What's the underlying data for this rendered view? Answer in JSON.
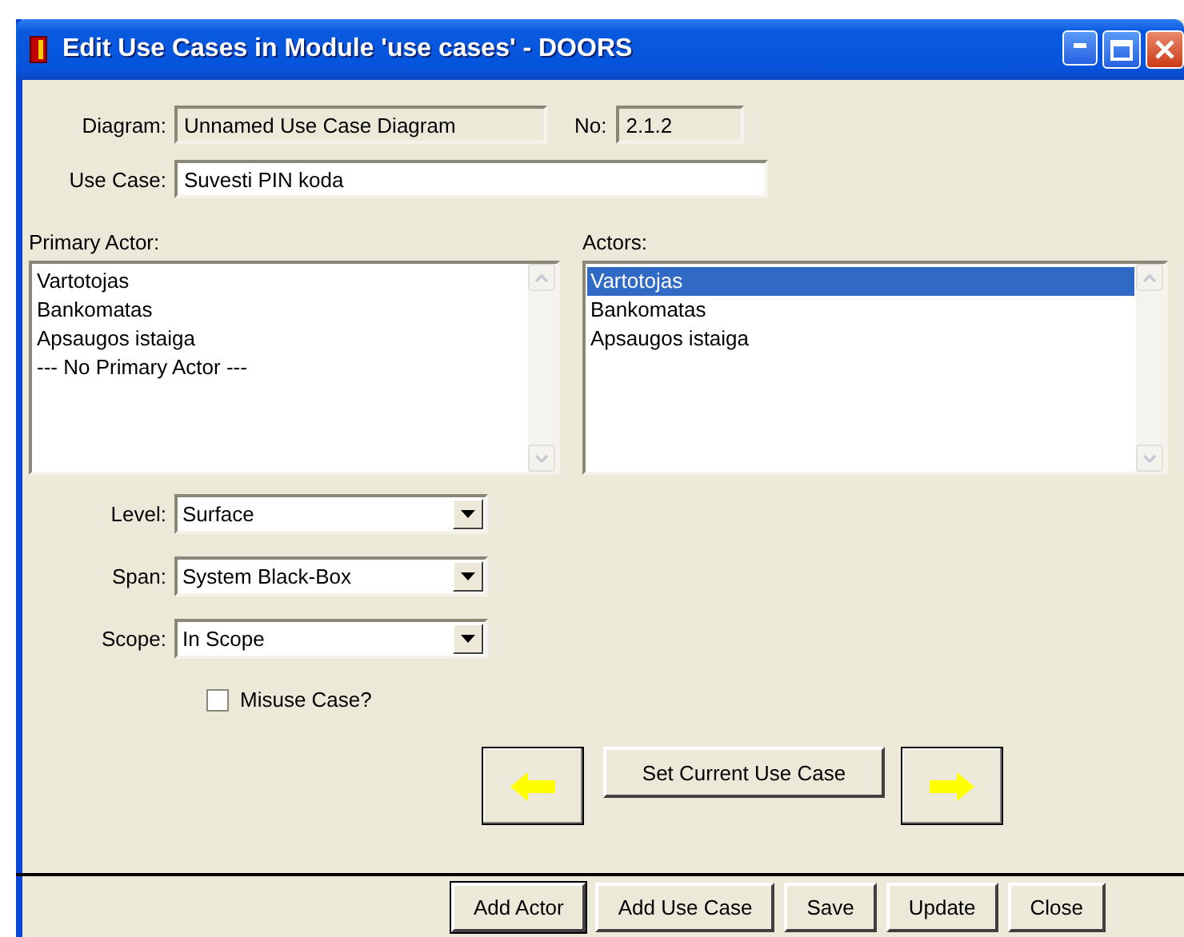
{
  "window": {
    "title": "Edit Use Cases in Module 'use cases' - DOORS"
  },
  "header_fields": [
    {
      "label": "Diagram:",
      "value": "Unnamed Use Case Diagram",
      "readonly": true
    },
    {
      "label": "No:",
      "value": "2.1.2",
      "readonly": true
    }
  ],
  "use_case": {
    "label": "Use Case:",
    "value": "Suvesti PIN koda",
    "readonly": false
  },
  "lists": [
    {
      "label": "Primary Actor:",
      "items": [
        {
          "text": "Vartotojas",
          "selected": false
        },
        {
          "text": "Bankomatas",
          "selected": false
        },
        {
          "text": "Apsaugos istaiga",
          "selected": false
        },
        {
          "text": "--- No Primary Actor ---",
          "selected": false
        }
      ]
    },
    {
      "label": "Actors:",
      "items": [
        {
          "text": "Vartotojas",
          "selected": true
        },
        {
          "text": "Bankomatas",
          "selected": false
        },
        {
          "text": "Apsaugos istaiga",
          "selected": false
        }
      ]
    }
  ],
  "dropdowns": [
    {
      "label": "Level:",
      "value": "Surface"
    },
    {
      "label": "Span:",
      "value": "System Black-Box"
    },
    {
      "label": "Scope:",
      "value": "In Scope"
    }
  ],
  "checkbox": {
    "label": "Misuse Case?",
    "checked": false
  },
  "navigation": [
    {
      "kind": "prev"
    },
    {
      "kind": "text",
      "label": "Set Current Use Case"
    },
    {
      "kind": "next"
    }
  ],
  "buttons": [
    {
      "label": "Add Actor",
      "default": true
    },
    {
      "label": "Add Use Case",
      "default": false
    },
    {
      "label": "Save",
      "default": false
    },
    {
      "label": "Update",
      "default": false
    },
    {
      "label": "Close",
      "default": false
    }
  ]
}
